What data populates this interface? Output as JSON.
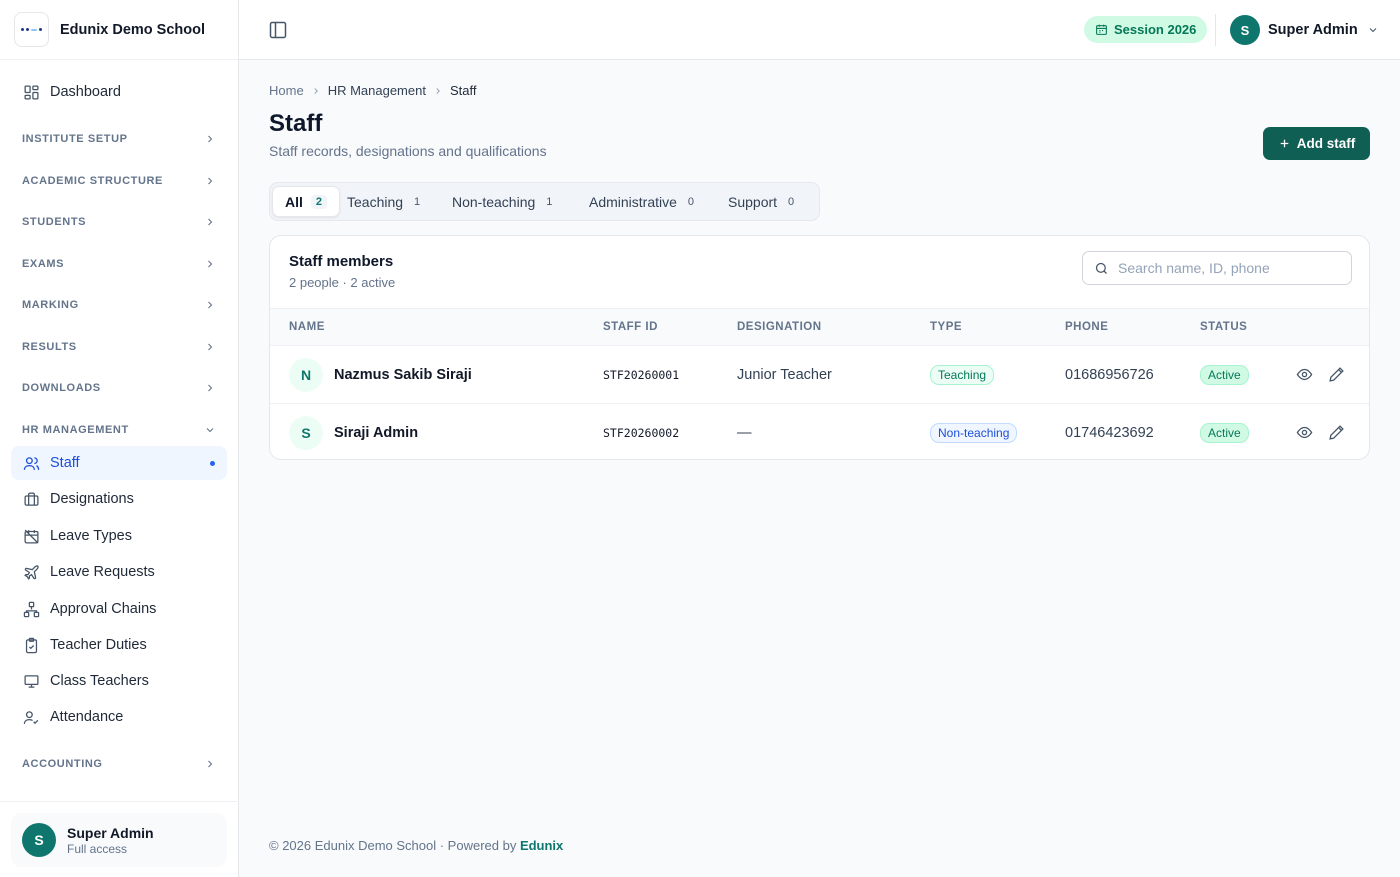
{
  "brand": {
    "name": "Edunix Demo School"
  },
  "sidebar": {
    "dashboard": "Dashboard",
    "sections": [
      "Institute Setup",
      "Academic Structure",
      "Students",
      "Exams",
      "Marking",
      "Results",
      "Downloads",
      "HR Management"
    ],
    "hr_items": [
      {
        "label": "Staff",
        "icon": "users-icon",
        "active": true
      },
      {
        "label": "Designations",
        "icon": "briefcase-icon"
      },
      {
        "label": "Leave Types",
        "icon": "calendar-off-icon"
      },
      {
        "label": "Leave Requests",
        "icon": "plane-icon"
      },
      {
        "label": "Approval Chains",
        "icon": "workflow-icon"
      },
      {
        "label": "Teacher Duties",
        "icon": "clipboard-icon"
      },
      {
        "label": "Class Teachers",
        "icon": "presentation-icon"
      },
      {
        "label": "Attendance",
        "icon": "user-check-icon"
      }
    ],
    "accounting": "Accounting",
    "user": {
      "initial": "S",
      "name": "Super Admin",
      "role": "Full access"
    }
  },
  "topbar": {
    "session": "Session 2026",
    "user": {
      "initial": "S",
      "name": "Super Admin"
    }
  },
  "breadcrumb": [
    "Home",
    "HR Management",
    "Staff"
  ],
  "page": {
    "title": "Staff",
    "subtitle": "Staff records, designations and qualifications",
    "add_button": "Add staff"
  },
  "tabs": [
    {
      "label": "All",
      "count": "2",
      "selected": true
    },
    {
      "label": "Teaching",
      "count": "1"
    },
    {
      "label": "Non-teaching",
      "count": "1"
    },
    {
      "label": "Administrative",
      "count": "0"
    },
    {
      "label": "Support",
      "count": "0"
    }
  ],
  "table": {
    "title": "Staff members",
    "summary": "2 people · 2 active",
    "search_placeholder": "Search name, ID, phone",
    "columns": [
      "Name",
      "Staff ID",
      "Designation",
      "Type",
      "Phone",
      "Status"
    ],
    "rows": [
      {
        "initial": "N",
        "name": "Nazmus Sakib Siraji",
        "staff_id": "STF20260001",
        "designation": "Junior Teacher",
        "type": "Teaching",
        "phone": "01686956726",
        "status": "Active"
      },
      {
        "initial": "S",
        "name": "Siraji Admin",
        "staff_id": "STF20260002",
        "designation": "—",
        "type": "Non-teaching",
        "phone": "01746423692",
        "status": "Active"
      }
    ]
  },
  "footer": {
    "text": "© 2026 Edunix Demo School · Powered by ",
    "link": "Edunix"
  },
  "colors": {
    "primary": "#0f5f54",
    "active_nav": "#1d4ed8",
    "accent_bg": "#d1fae5"
  }
}
